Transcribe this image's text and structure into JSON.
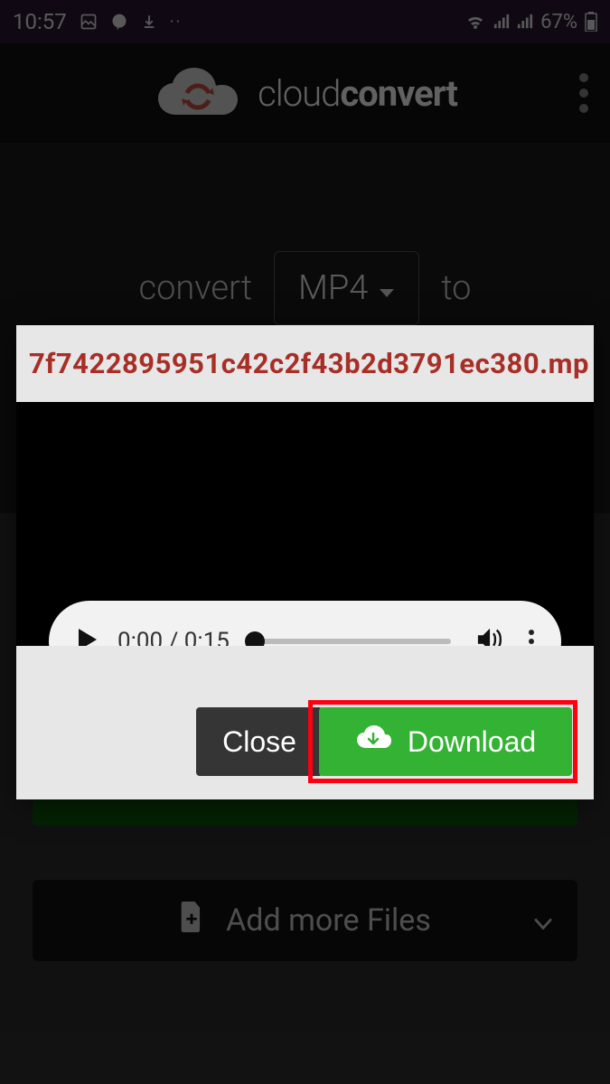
{
  "status": {
    "time": "10:57",
    "battery_pct": "67%"
  },
  "header": {
    "brand_light": "cloud",
    "brand_bold": "convert"
  },
  "bg": {
    "convert_label": "convert",
    "format": "MP4",
    "to_label": "to",
    "add_files_label": "Add more Files"
  },
  "modal": {
    "filename": "7f7422895951c42c2f43b2d3791ec380.mp",
    "player": {
      "time_current": "0:00",
      "time_total": "0:15"
    },
    "close_label": "Close",
    "download_label": "Download"
  }
}
